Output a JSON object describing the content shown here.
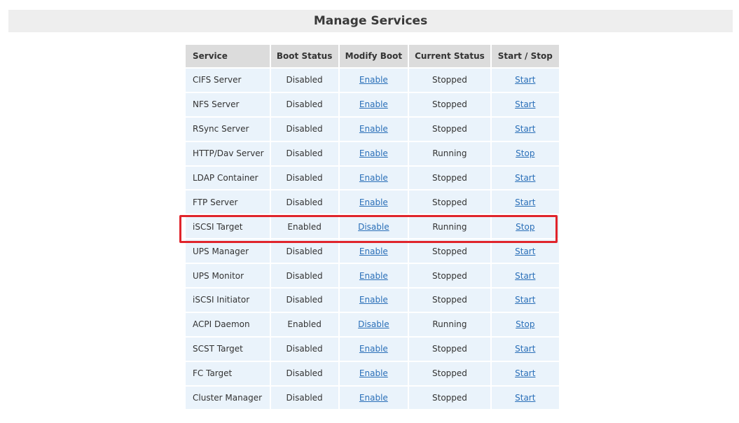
{
  "page": {
    "title": "Manage Services"
  },
  "table": {
    "headers": {
      "service": "Service",
      "boot_status": "Boot Status",
      "modify_boot": "Modify Boot",
      "current_status": "Current Status",
      "start_stop": "Start / Stop"
    },
    "rows": [
      {
        "service": "CIFS Server",
        "boot_status": "Disabled",
        "modify_boot": "Enable",
        "current_status": "Stopped",
        "action": "Start"
      },
      {
        "service": "NFS Server",
        "boot_status": "Disabled",
        "modify_boot": "Enable",
        "current_status": "Stopped",
        "action": "Start"
      },
      {
        "service": "RSync Server",
        "boot_status": "Disabled",
        "modify_boot": "Enable",
        "current_status": "Stopped",
        "action": "Start"
      },
      {
        "service": "HTTP/Dav Server",
        "boot_status": "Disabled",
        "modify_boot": "Enable",
        "current_status": "Running",
        "action": "Stop"
      },
      {
        "service": "LDAP Container",
        "boot_status": "Disabled",
        "modify_boot": "Enable",
        "current_status": "Stopped",
        "action": "Start"
      },
      {
        "service": "FTP Server",
        "boot_status": "Disabled",
        "modify_boot": "Enable",
        "current_status": "Stopped",
        "action": "Start"
      },
      {
        "service": "iSCSI Target",
        "boot_status": "Enabled",
        "modify_boot": "Disable",
        "current_status": "Running",
        "action": "Stop"
      },
      {
        "service": "UPS Manager",
        "boot_status": "Disabled",
        "modify_boot": "Enable",
        "current_status": "Stopped",
        "action": "Start"
      },
      {
        "service": "UPS Monitor",
        "boot_status": "Disabled",
        "modify_boot": "Enable",
        "current_status": "Stopped",
        "action": "Start"
      },
      {
        "service": "iSCSI Initiator",
        "boot_status": "Disabled",
        "modify_boot": "Enable",
        "current_status": "Stopped",
        "action": "Start"
      },
      {
        "service": "ACPI Daemon",
        "boot_status": "Enabled",
        "modify_boot": "Disable",
        "current_status": "Running",
        "action": "Stop"
      },
      {
        "service": "SCST Target",
        "boot_status": "Disabled",
        "modify_boot": "Enable",
        "current_status": "Stopped",
        "action": "Start"
      },
      {
        "service": "FC Target",
        "boot_status": "Disabled",
        "modify_boot": "Enable",
        "current_status": "Stopped",
        "action": "Start"
      },
      {
        "service": "Cluster Manager",
        "boot_status": "Disabled",
        "modify_boot": "Enable",
        "current_status": "Stopped",
        "action": "Start"
      }
    ]
  },
  "highlight": {
    "row_service": "iSCSI Target",
    "color": "#e0242b"
  },
  "colors": {
    "status_off": "#f7cf5d",
    "status_on": "#e2f5c2",
    "row_background": "#eaf3fb",
    "header_background": "#dcdcdc",
    "link": "#2a6fb8"
  }
}
